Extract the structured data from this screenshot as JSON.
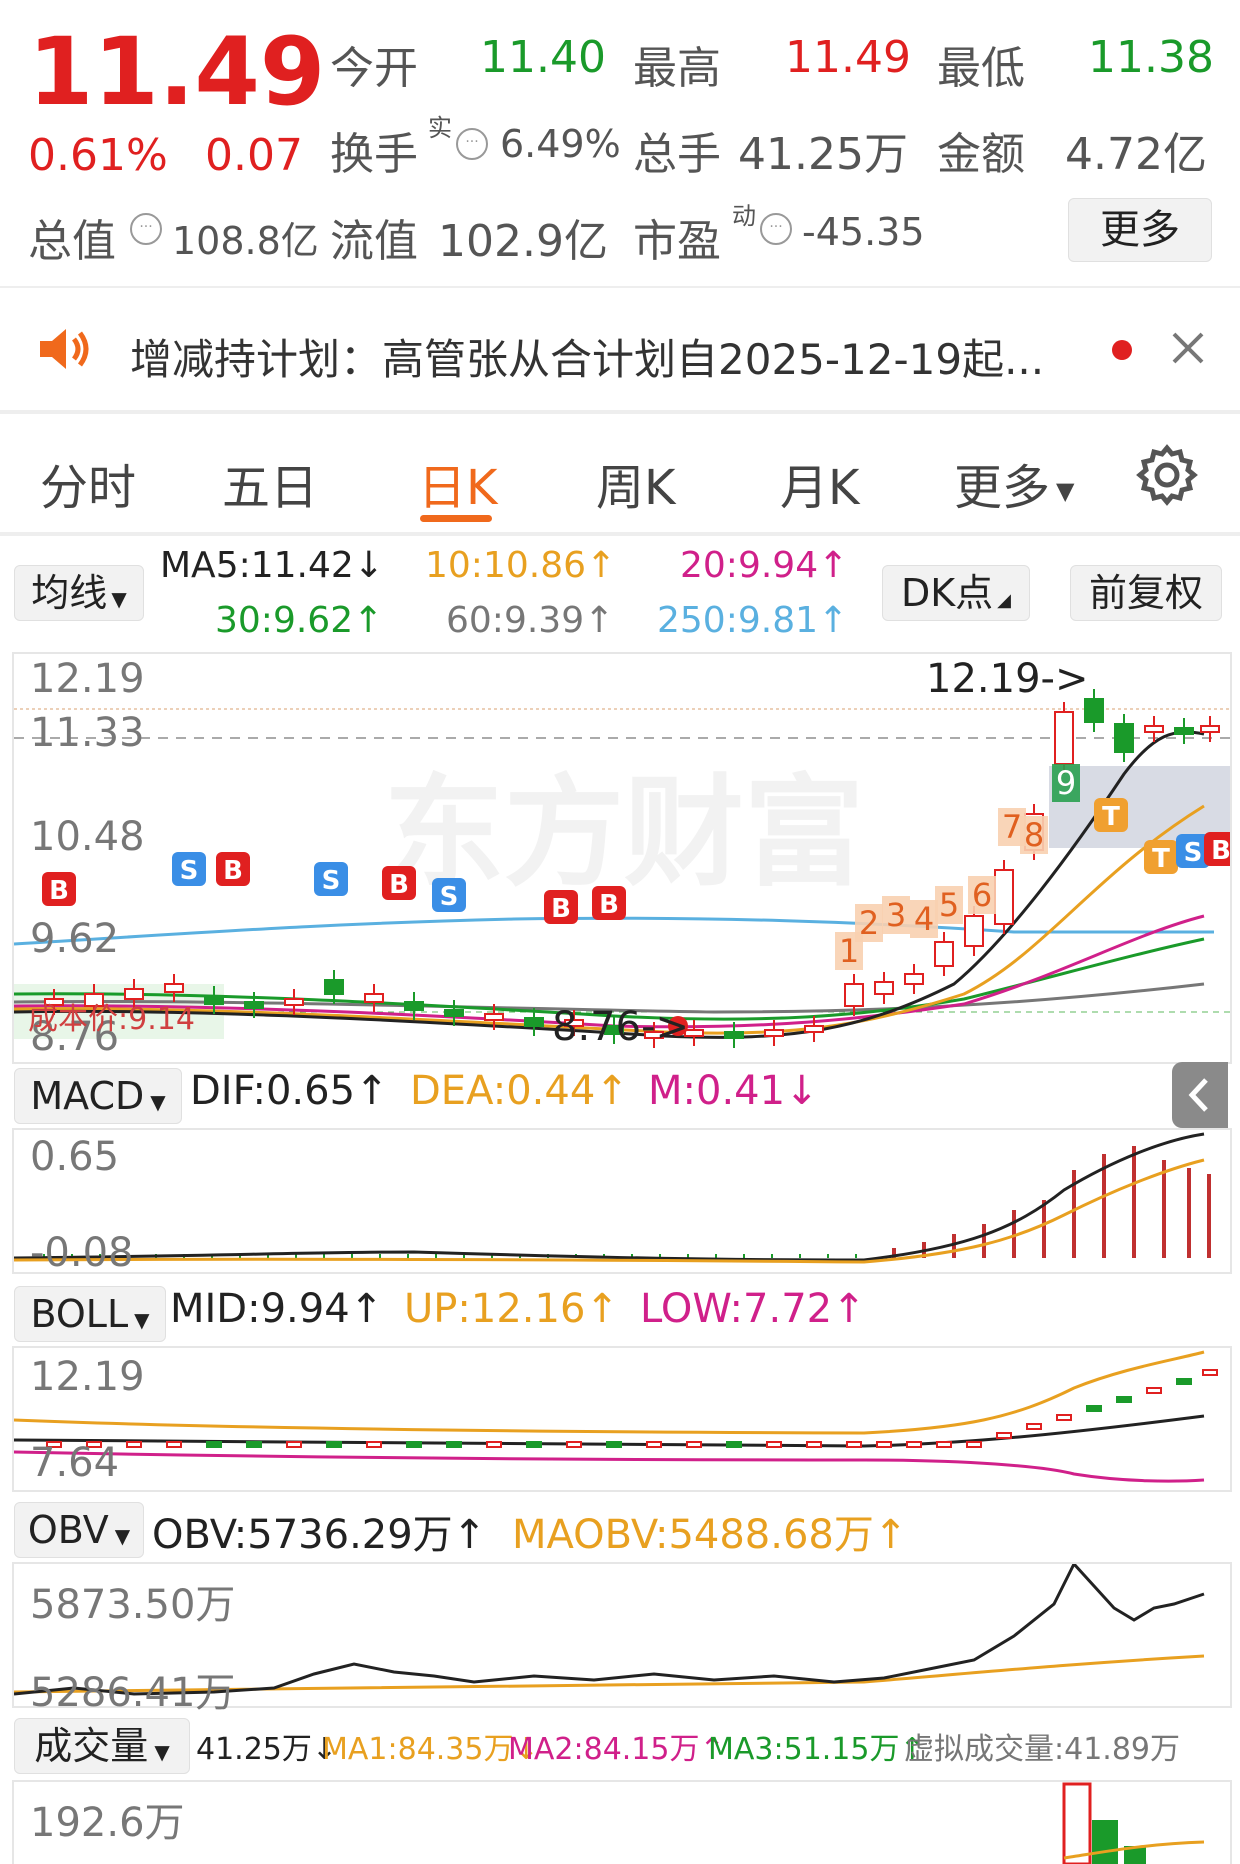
{
  "quote": {
    "price": "11.49",
    "change_pct": "0.61%",
    "change": "0.07",
    "open_label": "今开",
    "open": "11.40",
    "high_label": "最高",
    "high": "11.49",
    "low_label": "最低",
    "low": "11.38",
    "turnover_label": "换手",
    "turnover_sup": "实",
    "turnover": "6.49%",
    "volume_label": "总手",
    "volume": "41.25万",
    "amount_label": "金额",
    "amount": "4.72亿",
    "mcap_label": "总值",
    "mcap": "108.8亿",
    "float_label": "流值",
    "float": "102.9亿",
    "pe_label": "市盈",
    "pe_sup": "动",
    "pe": "-45.35",
    "more_label": "更多"
  },
  "notice": {
    "text": "增减持计划：高管张从合计划自2025-12-19起..."
  },
  "tabs": [
    "分时",
    "五日",
    "日K",
    "周K",
    "月K",
    "更多"
  ],
  "active_tab": "日K",
  "ma_bar": {
    "selector": "均线",
    "ma5": "MA5:11.42↓",
    "ma10": "10:10.86↑",
    "ma20": "20:9.94↑",
    "ma30": "30:9.62↑",
    "ma60": "60:9.39↑",
    "ma250": "250:9.81↑",
    "dk_label": "DK点",
    "adjust_label": "前复权"
  },
  "kline": {
    "ticks": [
      "12.19",
      "11.33",
      "10.48",
      "9.62",
      "8.76"
    ],
    "high_marker": "12.19->",
    "low_marker": "8.76->",
    "cost_label": "成本价:9.14",
    "seq_labels": [
      "1",
      "2",
      "3",
      "4",
      "5",
      "6",
      "7",
      "8",
      "9"
    ]
  },
  "macd": {
    "selector": "MACD",
    "dif": "DIF:0.65↑",
    "dea": "DEA:0.44↑",
    "m": "M:0.41↓",
    "ticks": [
      "0.65",
      "-0.08"
    ]
  },
  "boll": {
    "selector": "BOLL",
    "mid": "MID:9.94↑",
    "up": "UP:12.16↑",
    "low": "LOW:7.72↑",
    "ticks": [
      "12.19",
      "7.64"
    ]
  },
  "obv": {
    "selector": "OBV",
    "obv": "OBV:5736.29万↑",
    "maobv": "MAOBV:5488.68万↑",
    "ticks": [
      "5873.50万",
      "5286.41万"
    ]
  },
  "vol": {
    "selector": "成交量",
    "vol": "41.25万↓",
    "ma1": "MA1:84.35万↓",
    "ma2": "MA2:84.15万↑",
    "ma3": "MA3:51.15万↑",
    "virtual": "虚拟成交量:41.89万",
    "ticks": [
      "192.6万"
    ]
  },
  "colors": {
    "up": "#e02020",
    "down": "#1a9a2a",
    "accent": "#f0691c",
    "ma5": "#222222",
    "ma10": "#e8a020",
    "ma20": "#d0208a",
    "ma30": "#1a9a2a",
    "ma60": "#777777",
    "ma250": "#5ab0e0"
  }
}
